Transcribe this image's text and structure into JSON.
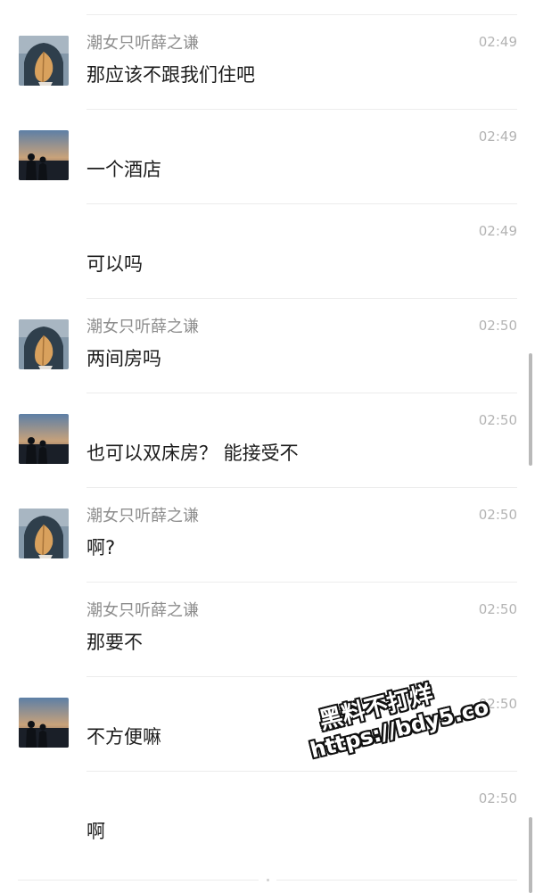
{
  "messages": [
    {
      "sender": "潮女只听薛之谦",
      "avatar": "leaf-avatar",
      "text": "那应该不跟我们住吧",
      "time": "02:49"
    },
    {
      "sender": "",
      "avatar": "sunset-avatar",
      "text": "一个酒店",
      "time": "02:49"
    },
    {
      "sender": "",
      "avatar": "",
      "text": "可以吗",
      "time": "02:49"
    },
    {
      "sender": "潮女只听薛之谦",
      "avatar": "leaf-avatar",
      "text": "两间房吗",
      "time": "02:50"
    },
    {
      "sender": "",
      "avatar": "sunset-avatar",
      "text": "也可以双床房？ 能接受不",
      "time": "02:50"
    },
    {
      "sender": "潮女只听薛之谦",
      "avatar": "leaf-avatar",
      "text": "啊?",
      "time": "02:50"
    },
    {
      "sender": "潮女只听薛之谦",
      "avatar": "",
      "text": "那要不",
      "time": "02:50"
    },
    {
      "sender": "",
      "avatar": "sunset-avatar",
      "text": "不方便嘛",
      "time": "02:50"
    },
    {
      "sender": "",
      "avatar": "",
      "text": "啊",
      "time": "02:50"
    }
  ],
  "watermark": {
    "line1": "黑料不打烊",
    "line2": "https://bdy5.co"
  }
}
